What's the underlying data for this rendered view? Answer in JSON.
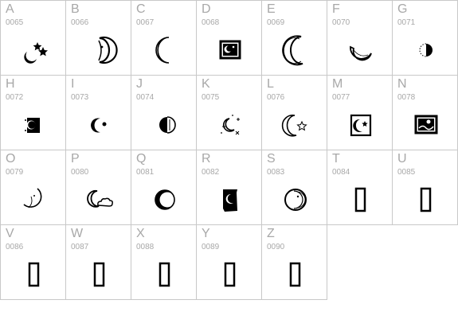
{
  "glyphs": [
    {
      "letter": "A",
      "code": "0065",
      "icon": "moon-two-stars-icon"
    },
    {
      "letter": "B",
      "code": "0066",
      "icon": "moon-face-crescent-icon"
    },
    {
      "letter": "C",
      "code": "0067",
      "icon": "crescent-outline-icon"
    },
    {
      "letter": "D",
      "code": "0068",
      "icon": "framed-moon-star-icon"
    },
    {
      "letter": "E",
      "code": "0069",
      "icon": "crescent-sketch-icon"
    },
    {
      "letter": "F",
      "code": "0070",
      "icon": "lying-crescent-icon"
    },
    {
      "letter": "G",
      "code": "0071",
      "icon": "half-moon-dotted-icon"
    },
    {
      "letter": "H",
      "code": "0072",
      "icon": "moon-box-dots-icon"
    },
    {
      "letter": "I",
      "code": "0073",
      "icon": "crescent-dot-icon"
    },
    {
      "letter": "J",
      "code": "0074",
      "icon": "half-moon-striped-icon"
    },
    {
      "letter": "K",
      "code": "0075",
      "icon": "moon-sparkles-icon"
    },
    {
      "letter": "L",
      "code": "0076",
      "icon": "crescent-star-icon"
    },
    {
      "letter": "M",
      "code": "0077",
      "icon": "framed-crescent-star-icon"
    },
    {
      "letter": "N",
      "code": "0078",
      "icon": "framed-moon-scene-icon"
    },
    {
      "letter": "O",
      "code": "0079",
      "icon": "moon-face-sketch-icon"
    },
    {
      "letter": "P",
      "code": "0080",
      "icon": "moon-cloud-icon"
    },
    {
      "letter": "Q",
      "code": "0081",
      "icon": "eclipse-moon-icon"
    },
    {
      "letter": "R",
      "code": "0082",
      "icon": "moon-tag-icon"
    },
    {
      "letter": "S",
      "code": "0083",
      "icon": "moon-face-circle-icon"
    },
    {
      "letter": "T",
      "code": "0084",
      "icon": "missing-glyph-icon"
    },
    {
      "letter": "U",
      "code": "0085",
      "icon": "missing-glyph-icon"
    },
    {
      "letter": "V",
      "code": "0086",
      "icon": "missing-glyph-icon"
    },
    {
      "letter": "W",
      "code": "0087",
      "icon": "missing-glyph-icon"
    },
    {
      "letter": "X",
      "code": "0088",
      "icon": "missing-glyph-icon"
    },
    {
      "letter": "Y",
      "code": "0089",
      "icon": "missing-glyph-icon"
    },
    {
      "letter": "Z",
      "code": "0090",
      "icon": "missing-glyph-icon"
    }
  ]
}
